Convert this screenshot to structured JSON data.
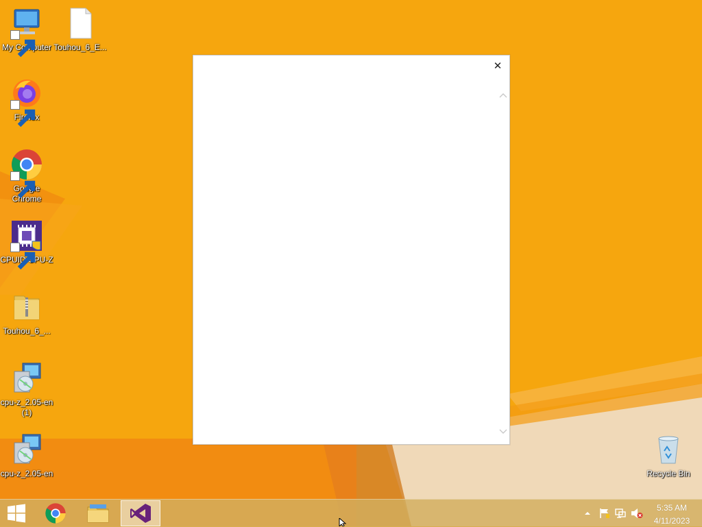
{
  "desktop": {
    "icons": [
      {
        "label": "My Computer"
      },
      {
        "label": "Touhou_6_E..."
      },
      {
        "label": "Firefox"
      },
      {
        "label": "Google\nChrome"
      },
      {
        "label": "CPUID CPU-Z"
      },
      {
        "label": "Touhou_6_..."
      },
      {
        "label": "cpu-z_2.05-en\n(1)"
      },
      {
        "label": "cpu-z_2.05-en"
      },
      {
        "label": "Recycle Bin"
      }
    ]
  },
  "dialog": {
    "close_glyph": "✕"
  },
  "taskbar": {
    "clock_time": "5:35 AM",
    "clock_date": "4/11/2023",
    "apps": [
      "start-button",
      "chrome",
      "file-explorer",
      "visual-studio"
    ]
  },
  "colors": {
    "wallpaper_orange": "#f6a60e",
    "taskbar": "#d2af5f",
    "vs_purple": "#68217a"
  }
}
